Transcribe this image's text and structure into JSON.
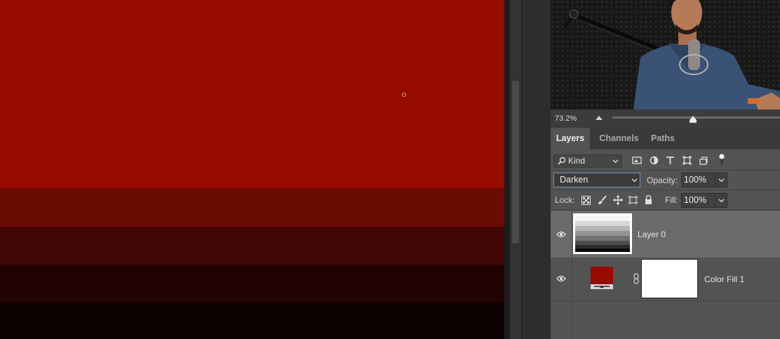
{
  "canvas": {
    "colors": {
      "base": "#960c00",
      "band1": "#6a0c04",
      "band2": "#420704",
      "band3": "#200302",
      "band4": "#0c0202"
    }
  },
  "navigator": {
    "zoom": "73.2%"
  },
  "tabs": [
    {
      "label": "Layers",
      "active": true
    },
    {
      "label": "Channels",
      "active": false
    },
    {
      "label": "Paths",
      "active": false
    }
  ],
  "filter": {
    "kind_label": "Kind",
    "icons": [
      "image-filter-icon",
      "adjustment-filter-icon",
      "type-filter-icon",
      "shape-filter-icon",
      "smart-object-filter-icon",
      "filter-toggle-icon"
    ]
  },
  "blend": {
    "mode": "Darken",
    "opacity_label": "Opacity:",
    "opacity": "100%"
  },
  "lock": {
    "label": "Lock:",
    "fill_label": "Fill:",
    "fill": "100%"
  },
  "layers": [
    {
      "name": "Layer 0",
      "selected": true
    },
    {
      "name": "Color Fill 1",
      "selected": false,
      "fill_color": "#960c00"
    }
  ]
}
